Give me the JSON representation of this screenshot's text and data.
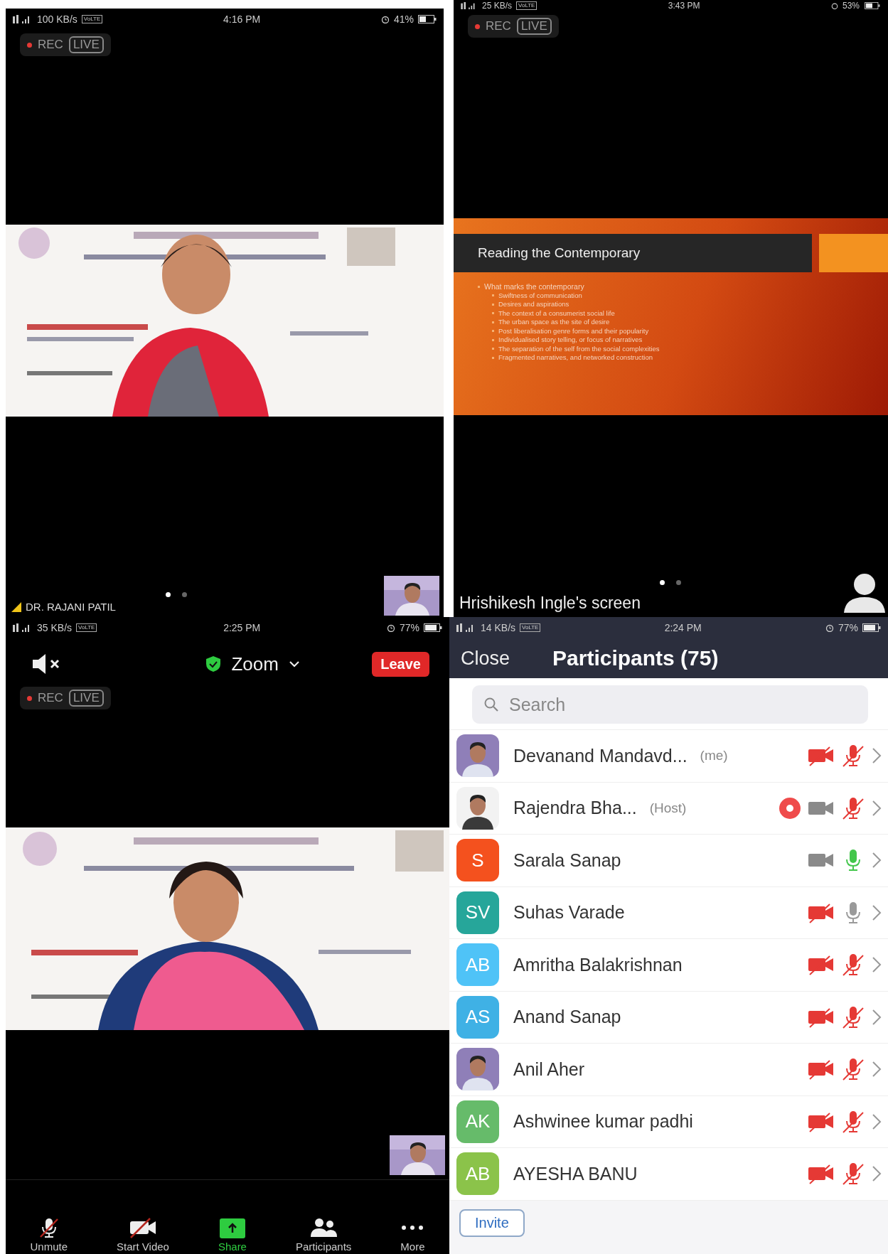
{
  "speaker_view": {
    "status_bar": {
      "network": "100 KB/s",
      "volte": "VoLTE",
      "time": "4:16 PM",
      "battery": "41%"
    },
    "rec": "REC",
    "live": "LIVE",
    "speaker_name": "DR. RAJANI PATIL",
    "page_dots": [
      {
        "selected": true
      },
      {
        "selected": false
      }
    ]
  },
  "screen_share_view": {
    "status_bar": {
      "network": "25 KB/s",
      "volte": "VoLTE",
      "time": "3:43 PM",
      "battery": "53%"
    },
    "rec": "REC",
    "live": "LIVE",
    "slide": {
      "title": "Reading the Contemporary",
      "bullets": [
        {
          "text": "What marks the contemporary",
          "children": [
            {
              "text": "Swiftness of communication"
            },
            {
              "text": "Desires and aspirations"
            },
            {
              "text": "The context of a consumerist social life"
            },
            {
              "text": "The urban space as the site of desire"
            },
            {
              "text": "Post liberalisation genre forms and their popularity"
            },
            {
              "text": "Individualised story telling, or focus of narratives"
            },
            {
              "text": "The separation of the self from the social complexities"
            },
            {
              "text": "Fragmented narratives, and networked construction"
            }
          ]
        }
      ]
    },
    "share_label": "Hrishikesh Ingle's screen",
    "page_dots": [
      {
        "selected": true
      },
      {
        "selected": false
      }
    ]
  },
  "meeting_view": {
    "status_bar": {
      "network": "35 KB/s",
      "volte": "VoLTE",
      "time": "2:25 PM",
      "battery": "77%"
    },
    "meeting_name": "Zoom",
    "leave": "Leave",
    "rec": "REC",
    "live": "LIVE",
    "toolbar": [
      {
        "kind": "mic_off",
        "label": "Unmute"
      },
      {
        "kind": "video_off",
        "label": "Start Video"
      },
      {
        "kind": "share",
        "label": "Share"
      },
      {
        "kind": "participants",
        "label": "Participants"
      },
      {
        "kind": "more",
        "label": "More"
      }
    ]
  },
  "participants_panel": {
    "status_bar": {
      "network": "14 KB/s",
      "volte": "VoLTE",
      "time": "2:24 PM",
      "battery": "77%"
    },
    "close": "Close",
    "title": "Participants (75)",
    "search": {
      "placeholder": "Search"
    },
    "participants": [
      {
        "name": "Devanand Mandavd...",
        "tag": "(me)",
        "recording": false,
        "video_on": false,
        "mic_muted": true,
        "speaking": false
      },
      {
        "name": "Rajendra Bha...",
        "tag": "(Host)",
        "recording": true,
        "video_on": true,
        "mic_muted": true,
        "speaking": false
      },
      {
        "name": "Sarala Sanap",
        "avatar": {
          "kind": "initials",
          "initials": "S",
          "color": "#f4511e"
        },
        "recording": false,
        "video_on": true,
        "mic_muted": false,
        "speaking": true
      },
      {
        "name": "Suhas Varade",
        "avatar": {
          "kind": "initials",
          "initials": "SV",
          "color": "#26a69a"
        },
        "recording": false,
        "video_on": false,
        "mic_muted": false,
        "speaking": false
      },
      {
        "name": "Amritha Balakrishnan",
        "avatar": {
          "kind": "initials",
          "initials": "AB",
          "color": "#4fc3f7"
        },
        "recording": false,
        "video_on": false,
        "mic_muted": true,
        "speaking": false
      },
      {
        "name": "Anand Sanap",
        "avatar": {
          "kind": "initials",
          "initials": "AS",
          "color": "#3fb1e5"
        },
        "recording": false,
        "video_on": false,
        "mic_muted": true,
        "speaking": false
      },
      {
        "name": "Anil Aher",
        "recording": false,
        "video_on": false,
        "mic_muted": true,
        "speaking": false
      },
      {
        "name": "Ashwinee kumar padhi",
        "avatar": {
          "kind": "initials",
          "initials": "AK",
          "color": "#66bb6a"
        },
        "recording": false,
        "video_on": false,
        "mic_muted": true,
        "speaking": false
      },
      {
        "name": "AYESHA BANU",
        "avatar": {
          "kind": "initials",
          "initials": "AB",
          "color": "#8bc34a"
        },
        "recording": false,
        "video_on": false,
        "mic_muted": true,
        "speaking": false
      }
    ],
    "invite": "Invite"
  }
}
